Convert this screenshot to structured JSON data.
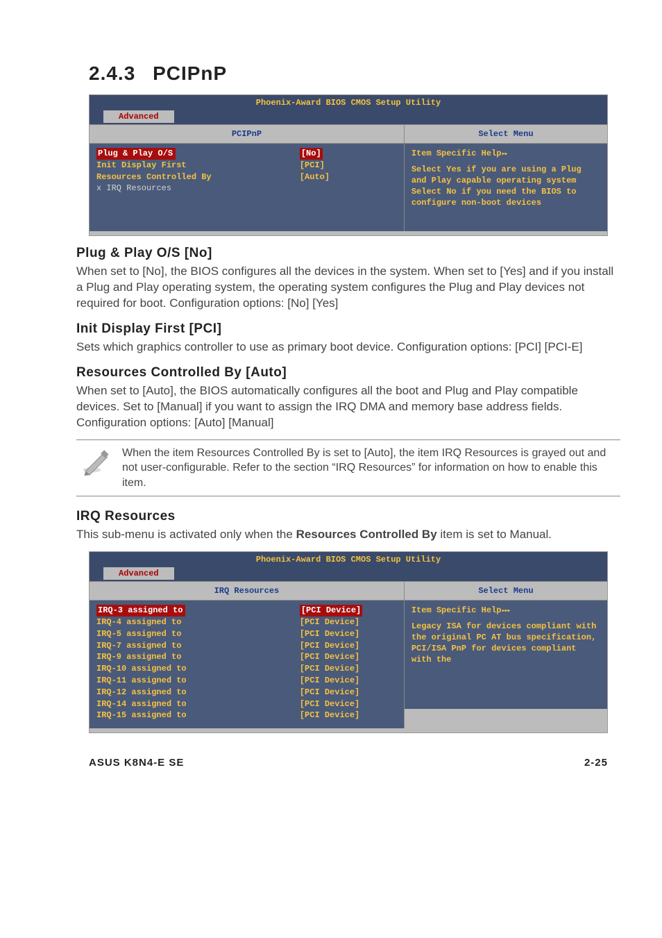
{
  "section": {
    "number": "2.4.3",
    "title": "PCIPnP"
  },
  "bios1": {
    "title": "Phoenix-Award BIOS CMOS Setup Utility",
    "tab": "Advanced",
    "left_header": "PCIPnP",
    "right_header": "Select Menu",
    "items": [
      {
        "label": "Plug & Play O/S",
        "value": "No",
        "highlight": true
      },
      {
        "label": "Init Display First",
        "value": "[PCI]"
      },
      {
        "label": "",
        "value": ""
      },
      {
        "label": "Resources Controlled By",
        "value": "[Auto]"
      },
      {
        "label": "x IRQ Resources",
        "value": "",
        "dim": true
      }
    ],
    "help_title": "Item Specific Help",
    "help_body": "Select Yes if you are using a Plug and Play capable operating system Select No if you need the BIOS to configure non-boot devices"
  },
  "sub1": {
    "title": "Plug & Play O/S [No]",
    "body": "When set to [No], the BIOS configures all the devices in the system. When set to [Yes] and if you install a Plug and Play operating system, the operating system configures the Plug and Play devices not required for boot. Configuration options: [No] [Yes]"
  },
  "sub2": {
    "title": "Init Display First [PCI]",
    "body": "Sets which graphics controller to use as primary boot device. Configuration options: [PCI] [PCI-E]"
  },
  "sub3": {
    "title": "Resources Controlled By [Auto]",
    "body": "When set to [Auto], the BIOS automatically configures all the boot and Plug and Play compatible devices. Set to [Manual] if you want to assign the IRQ DMA and memory base address fields.\nConfiguration options: [Auto] [Manual]"
  },
  "note": {
    "text": "When the item Resources Controlled By is set to [Auto], the item IRQ Resources is grayed out and not user-configurable. Refer to the section “IRQ Resources” for information on how to enable this item."
  },
  "sub4": {
    "title": "IRQ Resources",
    "body_pre": "This sub-menu is activated only when the ",
    "body_strong": "Resources Controlled By",
    "body_post": " item is set to Manual."
  },
  "bios2": {
    "title": "Phoenix-Award BIOS CMOS Setup Utility",
    "tab": "Advanced",
    "left_header": "IRQ Resources",
    "right_header": "Select Menu",
    "items": [
      {
        "label": "IRQ-3 assigned to",
        "value": "PCI Device",
        "highlight": true
      },
      {
        "label": "IRQ-4 assigned to",
        "value": "[PCI Device]"
      },
      {
        "label": "IRQ-5 assigned to",
        "value": "[PCI Device]"
      },
      {
        "label": "IRQ-7 assigned to",
        "value": "[PCI Device]"
      },
      {
        "label": "IRQ-9 assigned to",
        "value": "[PCI Device]"
      },
      {
        "label": "IRQ-10 assigned to",
        "value": "[PCI Device]"
      },
      {
        "label": "IRQ-11 assigned to",
        "value": "[PCI Device]"
      },
      {
        "label": "IRQ-12 assigned to",
        "value": "[PCI Device]"
      },
      {
        "label": "IRQ-14 assigned to",
        "value": "[PCI Device]"
      },
      {
        "label": "IRQ-15 assigned to",
        "value": "[PCI Device]"
      }
    ],
    "help_title": "Item Specific Help",
    "help_body": "Legacy ISA for devices compliant with the original PC AT bus specification, PCI/ISA PnP for devices compliant with the"
  },
  "footer": {
    "left": "ASUS K8N4-E SE",
    "right": "2-25"
  },
  "chart_data": null
}
